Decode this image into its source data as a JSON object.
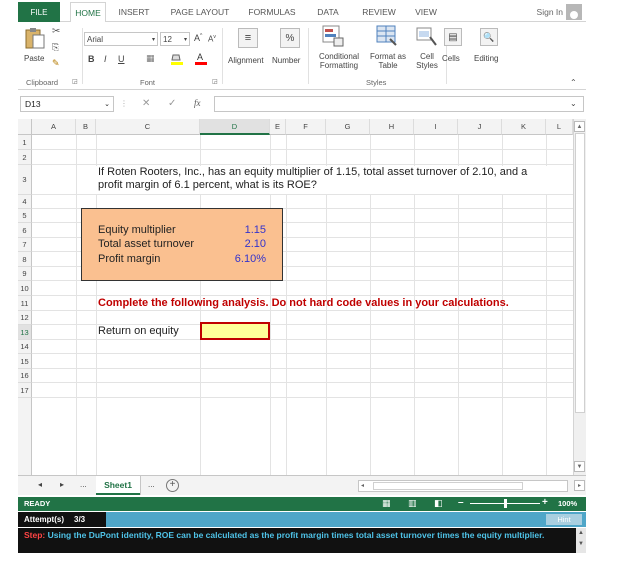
{
  "ribbon_tabs": [
    "FILE",
    "HOME",
    "INSERT",
    "PAGE LAYOUT",
    "FORMULAS",
    "DATA",
    "REVIEW",
    "VIEW"
  ],
  "active_tab": "HOME",
  "sign_in": "Sign In",
  "ribbon": {
    "paste": "Paste",
    "font_name": "Arial",
    "font_size": "12",
    "bold": "B",
    "italic": "I",
    "underline": "U",
    "alignment": "Alignment",
    "number": "Number",
    "percent": "%",
    "conditional_formatting_1": "Conditional",
    "conditional_formatting_2": "Formatting",
    "format_as_table_1": "Format as",
    "format_as_table_2": "Table",
    "cell_styles_1": "Cell",
    "cell_styles_2": "Styles",
    "cells": "Cells",
    "editing": "Editing",
    "group_clipboard": "Clipboard",
    "group_font": "Font",
    "group_styles": "Styles"
  },
  "formula_bar": {
    "name_box": "D13",
    "fx": "fx",
    "content": ""
  },
  "columns": [
    "A",
    "B",
    "C",
    "D",
    "E",
    "F",
    "G",
    "H",
    "I",
    "J",
    "K",
    "L"
  ],
  "selected_column": "D",
  "rows": [
    "1",
    "2",
    "3",
    "4",
    "5",
    "6",
    "7",
    "8",
    "9",
    "10",
    "11",
    "12",
    "13",
    "14",
    "15",
    "16",
    "17"
  ],
  "selected_row": "13",
  "question_line1": "If Roten Rooters, Inc., has an equity multiplier of 1.15, total asset turnover of 2.10, and a",
  "question_line2": "profit margin of 6.1 percent, what is its ROE?",
  "inputs": [
    {
      "label": "Equity multiplier",
      "value": "1.15"
    },
    {
      "label": "Total asset turnover",
      "value": "2.10"
    },
    {
      "label": "Profit margin",
      "value": "6.10%"
    }
  ],
  "instruction": "Complete the following analysis. Do not hard code values in your calculations.",
  "output_label": "Return on equity",
  "output_value": "",
  "sheet": {
    "tab_name": "Sheet1",
    "ellipsis_left": "...",
    "ellipsis_right": "..."
  },
  "status": {
    "ready": "READY",
    "zoom": "100%"
  },
  "attempt": {
    "label": "Attempt(s)",
    "value": "3/3",
    "hint": "Hint"
  },
  "step": {
    "label": "Step:",
    "text": "Using the DuPont identity, ROE can be calculated as the profit margin times total asset turnover times the equity multiplier."
  },
  "colors": {
    "excel_green": "#217346",
    "input_box": "#fac090",
    "input_values": "#3333cc",
    "instruction_red": "#c00000",
    "output_cell": "#ffff99"
  }
}
